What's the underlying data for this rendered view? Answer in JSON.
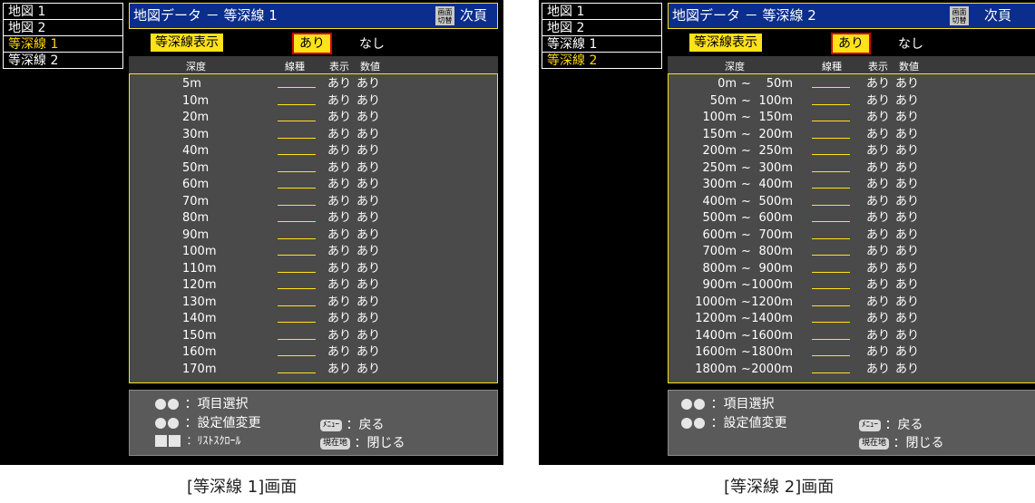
{
  "screen1": {
    "sidebar": [
      "地図 1",
      "地図 2",
      "等深線 1",
      "等深線 2"
    ],
    "active_index": 2,
    "title": "地図データ － 等深線 1",
    "switch_label": "画面\n切替",
    "next_label": "次頁",
    "toggle_label": "等深線表示",
    "option_on": "あり",
    "option_off": "なし",
    "columns": {
      "depth": "深度",
      "linetype": "線種",
      "display": "表示",
      "value": "数値"
    },
    "rows": [
      {
        "depth": "5m",
        "display": "あり",
        "value": "あり"
      },
      {
        "depth": "10m",
        "display": "あり",
        "value": "あり"
      },
      {
        "depth": "20m",
        "display": "あり",
        "value": "あり"
      },
      {
        "depth": "30m",
        "display": "あり",
        "value": "あり"
      },
      {
        "depth": "40m",
        "display": "あり",
        "value": "あり"
      },
      {
        "depth": "50m",
        "display": "あり",
        "value": "あり"
      },
      {
        "depth": "60m",
        "display": "あり",
        "value": "あり"
      },
      {
        "depth": "70m",
        "display": "あり",
        "value": "あり"
      },
      {
        "depth": "80m",
        "display": "あり",
        "value": "あり"
      },
      {
        "depth": "90m",
        "display": "あり",
        "value": "あり"
      },
      {
        "depth": "100m",
        "display": "あり",
        "value": "あり"
      },
      {
        "depth": "110m",
        "display": "あり",
        "value": "あり"
      },
      {
        "depth": "120m",
        "display": "あり",
        "value": "あり"
      },
      {
        "depth": "130m",
        "display": "あり",
        "value": "あり"
      },
      {
        "depth": "140m",
        "display": "あり",
        "value": "あり"
      },
      {
        "depth": "150m",
        "display": "あり",
        "value": "あり"
      },
      {
        "depth": "160m",
        "display": "あり",
        "value": "あり"
      },
      {
        "depth": "170m",
        "display": "あり",
        "value": "あり"
      }
    ],
    "help": {
      "select_text": "：項目選択",
      "change_text": "：設定値変更",
      "scroll_text": "：ﾘｽﾄｽｸﾛｰﾙ",
      "menu_key": "ﾒﾆｭｰ",
      "menu_text": "：戻る",
      "current_key": "現在地",
      "current_text": "：閉じる"
    },
    "caption": "[等深線 1]画面"
  },
  "screen2": {
    "sidebar": [
      "地図 1",
      "地図 2",
      "等深線 1",
      "等深線 2"
    ],
    "active_index": 3,
    "title": "地図データ － 等深線 2",
    "switch_label": "画面\n切替",
    "next_label": "次頁",
    "toggle_label": "等深線表示",
    "option_on": "あり",
    "option_off": "なし",
    "columns": {
      "depth": "深度",
      "linetype": "線種",
      "display": "表示",
      "value": "数値"
    },
    "rows": [
      {
        "from": "0m",
        "to": "50m",
        "display": "あり",
        "value": "あり"
      },
      {
        "from": "50m",
        "to": "100m",
        "display": "あり",
        "value": "あり"
      },
      {
        "from": "100m",
        "to": "150m",
        "display": "あり",
        "value": "あり"
      },
      {
        "from": "150m",
        "to": "200m",
        "display": "あり",
        "value": "あり"
      },
      {
        "from": "200m",
        "to": "250m",
        "display": "あり",
        "value": "あり"
      },
      {
        "from": "250m",
        "to": "300m",
        "display": "あり",
        "value": "あり"
      },
      {
        "from": "300m",
        "to": "400m",
        "display": "あり",
        "value": "あり"
      },
      {
        "from": "400m",
        "to": "500m",
        "display": "あり",
        "value": "あり"
      },
      {
        "from": "500m",
        "to": "600m",
        "display": "あり",
        "value": "あり"
      },
      {
        "from": "600m",
        "to": "700m",
        "display": "あり",
        "value": "あり"
      },
      {
        "from": "700m",
        "to": "800m",
        "display": "あり",
        "value": "あり"
      },
      {
        "from": "800m",
        "to": "900m",
        "display": "あり",
        "value": "あり"
      },
      {
        "from": "900m",
        "to": "1000m",
        "display": "あり",
        "value": "あり"
      },
      {
        "from": "1000m",
        "to": "1200m",
        "display": "あり",
        "value": "あり"
      },
      {
        "from": "1200m",
        "to": "1400m",
        "display": "あり",
        "value": "あり"
      },
      {
        "from": "1400m",
        "to": "1600m",
        "display": "あり",
        "value": "あり"
      },
      {
        "from": "1600m",
        "to": "1800m",
        "display": "あり",
        "value": "あり"
      },
      {
        "from": "1800m",
        "to": "2000m",
        "display": "あり",
        "value": "あり"
      }
    ],
    "help": {
      "select_text": "：項目選択",
      "change_text": "：設定値変更",
      "menu_key": "ﾒﾆｭｰ",
      "menu_text": "：戻る",
      "current_key": "現在地",
      "current_text": "：閉じる"
    },
    "caption": "[等深線 2]画面"
  }
}
